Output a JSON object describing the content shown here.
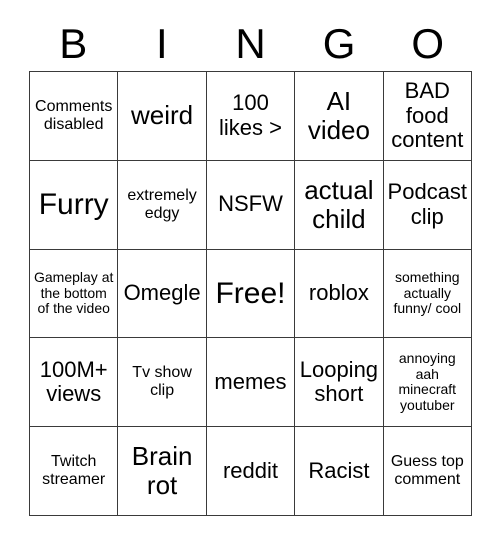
{
  "card": {
    "title": "BINGO",
    "header_letters": [
      "B",
      "I",
      "N",
      "G",
      "O"
    ],
    "rows": 5,
    "columns": 5,
    "text_color": "#000000",
    "background_color": "#ffffff",
    "border_color": "#3a3a3a",
    "cells": [
      [
        {
          "text": "Comments disabled",
          "size": "sm"
        },
        {
          "text": "weird",
          "size": "lg"
        },
        {
          "text": "100 likes >",
          "size": "md"
        },
        {
          "text": "AI video",
          "size": "lg"
        },
        {
          "text": "BAD food content",
          "size": "md"
        }
      ],
      [
        {
          "text": "Furry",
          "size": "xl"
        },
        {
          "text": "extremely edgy",
          "size": "sm"
        },
        {
          "text": "NSFW",
          "size": "md"
        },
        {
          "text": "actual child",
          "size": "lg"
        },
        {
          "text": "Podcast clip",
          "size": "md"
        }
      ],
      [
        {
          "text": "Gameplay at the bottom of the video",
          "size": "xs"
        },
        {
          "text": "Omegle",
          "size": "md"
        },
        {
          "text": "Free!",
          "size": "xl"
        },
        {
          "text": "roblox",
          "size": "md"
        },
        {
          "text": "something actually funny/ cool",
          "size": "xs"
        }
      ],
      [
        {
          "text": "100M+ views",
          "size": "md"
        },
        {
          "text": "Tv show clip",
          "size": "sm"
        },
        {
          "text": "memes",
          "size": "md"
        },
        {
          "text": "Looping short",
          "size": "md"
        },
        {
          "text": "annoying aah minecraft youtuber",
          "size": "xs"
        }
      ],
      [
        {
          "text": "Twitch streamer",
          "size": "sm"
        },
        {
          "text": "Brain rot",
          "size": "lg"
        },
        {
          "text": "reddit",
          "size": "md"
        },
        {
          "text": "Racist",
          "size": "md"
        },
        {
          "text": "Guess top comment",
          "size": "sm"
        }
      ]
    ]
  }
}
